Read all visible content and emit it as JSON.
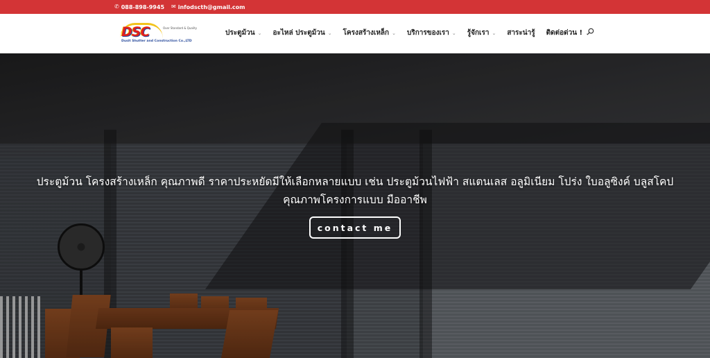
{
  "topbar": {
    "phone": "088-898-9945",
    "email": "infodscth@gmail.com",
    "bg_color": "#d33436"
  },
  "logo": {
    "brand": "DSC",
    "tagline": "Over Standard & Quality",
    "company": "Dusit Shutter and Construction Co.,LTD"
  },
  "nav": {
    "items": [
      {
        "label": "ประตูม้วน",
        "has_dropdown": true
      },
      {
        "label": "อะไหล่ ประตูม้วน",
        "has_dropdown": true
      },
      {
        "label": "โครงสร้างเหล็ก",
        "has_dropdown": true
      },
      {
        "label": "บริการของเรา",
        "has_dropdown": true
      },
      {
        "label": "รู้จักเรา",
        "has_dropdown": true
      },
      {
        "label": "สาระน่ารู้",
        "has_dropdown": false
      },
      {
        "label": "ติดต่อด่วน !",
        "has_dropdown": true
      }
    ],
    "search_icon": "search-icon"
  },
  "hero": {
    "line1": "ประตูม้วน โครงสร้างเหล็ก คุณภาพดี ราคาประหยัดมีให้เลือกหลายแบบ เช่น ประตูม้วนไฟฟ้า สแตนเลส อลูมิเนียม โปร่ง ใบอลูซิงค์ บลูสโคป",
    "line2": "คุณภาพโครงการแบบ มืออาชีพ",
    "button_label": "contact me"
  }
}
